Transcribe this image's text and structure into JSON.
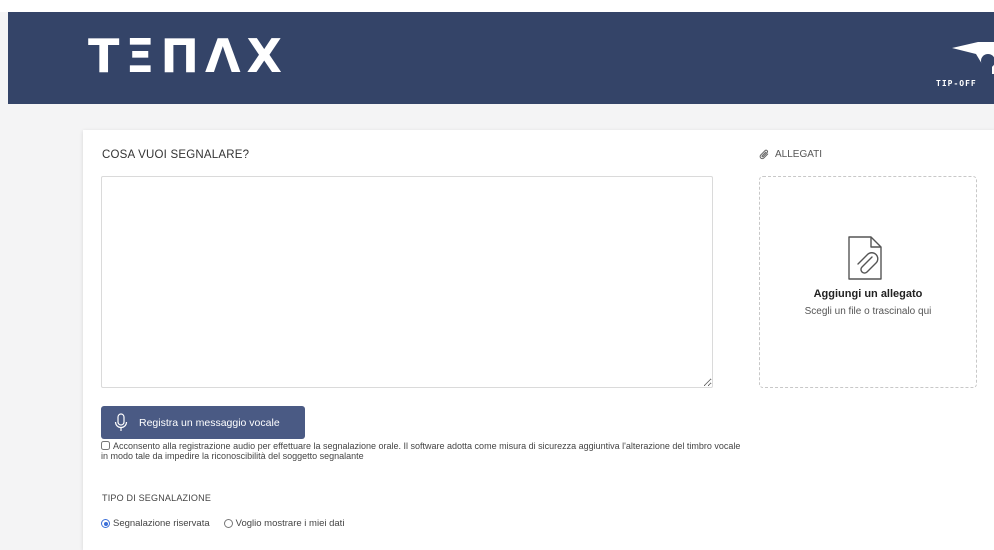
{
  "header": {
    "logo_text": "TΞПΛX",
    "partner_text": "TIP-OFF"
  },
  "form": {
    "question_label": "COSA VUOI SEGNALARE?",
    "message_value": "",
    "attachments": {
      "label": "ALLEGATI",
      "dropzone_title": "Aggiungi un allegato",
      "dropzone_subtitle": "Scegli un file o trascinalo qui"
    },
    "record_button_label": "Registra un messaggio vocale",
    "consent_text": "Acconsento alla registrazione audio per effettuare la segnalazione orale. Il software adotta come misura di sicurezza aggiuntiva l'alterazione del timbro vocale in modo tale da impedire la riconoscibilità del soggetto segnalante",
    "consent_checked": false,
    "report_type": {
      "label": "TIPO DI SEGNALAZIONE",
      "options": [
        {
          "label": "Segnalazione riservata",
          "selected": true
        },
        {
          "label": "Voglio mostrare i miei dati",
          "selected": false
        }
      ]
    }
  },
  "colors": {
    "header_bg": "#344468",
    "button_bg": "#4a5a84",
    "radio_accent": "#3b6fd8"
  },
  "icons": [
    "paperclip-icon",
    "file-attachment-icon",
    "microphone-icon",
    "tip-off-logo-icon"
  ]
}
